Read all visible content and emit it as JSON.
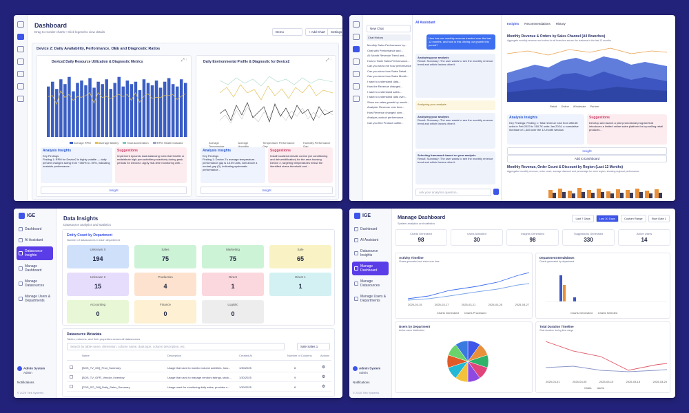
{
  "w1": {
    "title": "Dashboard",
    "subtitle": "Drag to reorder charts • Click legend to view details",
    "controls": {
      "select_value": "Demo",
      "add_chart": "+ Add Chart",
      "settings": "Settings"
    },
    "section_title": "Device 2: Daily Availability, Performance, OEE and Diagnostic Ratios",
    "chart1": {
      "title": "Device2 Daily Resource Utilization & Diagnostic Metrics",
      "legend": [
        "Average RPM",
        "Average Battery",
        "Total Acceleration",
        "RPM Health Indicator"
      ],
      "bars": [
        42,
        46,
        40,
        48,
        44,
        50,
        38,
        45,
        47,
        43,
        49,
        41,
        46,
        44,
        48,
        40,
        45,
        50,
        42,
        47,
        44,
        46,
        39,
        48,
        45,
        43,
        47,
        41,
        46,
        49,
        44,
        42,
        48,
        45
      ]
    },
    "chart2": {
      "title": "Daily Environmental Profile & Diagnostic for Device2",
      "legend": [
        "Average Temperature",
        "Average Humidity",
        "Temperature Performance Gap",
        "Humidity Performance Gap"
      ]
    },
    "insight1": {
      "title": "Analysis Insights",
      "key": "Key Findings",
      "body": "Finding 1: RPM for Device2 is highly volatile — daily percent changes swing from +350% to -90%, indicating unstable performance…"
    },
    "sugg1": {
      "title": "Suggestions",
      "body": "Implement dynamic load-balancing rules that throttle or redistribute high-rpm activities proactively during peak periods for Device2. Apply real-time monitoring with…"
    },
    "insight2": {
      "title": "Analysis Insights",
      "key": "Key Findings",
      "body": "Finding 1: Device 2's average temperature-performance gap is 18.09 units, well above a neutral gap (0), indicating systematic performance…"
    },
    "sugg2": {
      "title": "Suggestions",
      "body": "Install localized climate control (air conditioning and dehumidification) for the area housing Device 2, targeting temperatures below the identified stress threshold and…"
    },
    "insight_btn": "Insight"
  },
  "w2": {
    "chat_label": "AI Assistant",
    "new_chat": "New Chat",
    "chat_history": "Chat History",
    "history": [
      "Monthly Sales Performance by...",
      "Chat with Performance and...",
      "AI: Month Revenue Trend and...",
      "How to Table Sales Performance...",
      "Can you show me how performance...",
      "Can you show how Sales Detail...",
      "Can you show how Sales Month...",
      "I want to understand data...",
      "How the Revenue changed...",
      "I want to understand sales...",
      "I want to understand data over...",
      "Show me sales growth by month...",
      "Analysis: Revenue over time...",
      "How Revenue changed over...",
      "Analyze product performance...",
      "Can you find Product outlier..."
    ],
    "user_msg": "How has our monthly revenue trended over the last 12 months, and how is this driving our growth this period?",
    "steps": [
      "Analyzing your analysis",
      "Analyzing your analysis",
      "Selecting framework based on your analysis"
    ],
    "step_body": "Result: Summary: The user wants to see the monthly revenue trend and which factors drive it.",
    "input_placeholder": "Ask your analytics question...",
    "tabs": [
      "Insights",
      "Recommendations",
      "History"
    ],
    "chart1_title": "Monthly Revenue & Orders by Sales Channel (All Branches)",
    "chart1_sub": "Aggregate monthly revenue and orders for all branches across the business in the last 12 months",
    "legend1": [
      "Retail",
      "Online",
      "Wholesale",
      "Partner"
    ],
    "insights_title": "Analysis Insights",
    "insights_body": "Key Findings: Finding 1: Total revenue rose from 288.6K units in Feb 2023 to 318.7K units Jan 2024, a cumulative increase of 1,483 over the 12-month window.",
    "sugg_title": "Suggestions",
    "sugg_body": "Develop and launch a pilot promotional program that introduces a limited online sales platform for top-selling retail products…",
    "insight_btn": "Insight",
    "add_btn": "Add to Dashboard",
    "chart2_title": "Monthly Revenue, Order Count & Discount by Region (Last 12 Months)",
    "chart2_sub": "Aggregates monthly revenue, order count, average discount and percentage for each region, showing regional performance."
  },
  "w3": {
    "brand": "IGE",
    "nav": [
      "Dashboard",
      "AI Assistant",
      "Datasource Insights",
      "Manage Dashboard",
      "Manage Datasources",
      "Manage Users & Departments"
    ],
    "active": 2,
    "title": "Data Insights",
    "subtitle": "Datasource analytics and statistics",
    "sec_title": "Entity Count by Department",
    "sec_sub": "Number of datasources in each department",
    "tiles": [
      {
        "label": "Unknown X",
        "value": "194",
        "color": "#cfe0fb"
      },
      {
        "label": "Sales",
        "value": "75",
        "color": "#cdf3d7"
      },
      {
        "label": "Marketing",
        "value": "75",
        "color": "#cdf3d7"
      },
      {
        "label": "Sale",
        "value": "65",
        "color": "#f9f2c5"
      },
      {
        "label": "Unknown 2",
        "value": "15",
        "color": "#e6dcfb"
      },
      {
        "label": "Production",
        "value": "4",
        "color": "#fde3cf"
      },
      {
        "label": "Direct",
        "value": "1",
        "color": "#fbd7de"
      },
      {
        "label": "Direct 1",
        "value": "1",
        "color": "#d3f0f3"
      },
      {
        "label": "Accounting",
        "value": "0",
        "color": "#e8f7d6"
      },
      {
        "label": "Finance",
        "value": "0",
        "color": "#fdf0d3"
      },
      {
        "label": "Logistic",
        "value": "0",
        "color": "#ededed"
      }
    ],
    "meta_title": "Datasource Metadata",
    "meta_sub": "Tables, columns, and their properties across all datasources",
    "search_placeholder": "Search by table name, dimension, column name, data type, column description, etc.",
    "sort": "Sale Sales 1",
    "cols": [
      "Name",
      "Description",
      "Created At",
      "Number of Columns",
      "Actions"
    ],
    "rows": [
      {
        "name": "[BOS_TV_ON]_Prod_Summary",
        "desc": "Usage that used to monitor volume activities, how...",
        "date": "1/30/2025",
        "cols": "8"
      },
      {
        "name": "[BOS_TV_OFF]_Vendor_Inventory",
        "desc": "Usage that used to manage vendors listings, stock...",
        "date": "1/30/2025",
        "cols": "9"
      },
      {
        "name": "[POS_SO_ON]_Daily_Sales_Summary",
        "desc": "Usage used for monitoring daily sales, provides s...",
        "date": "1/30/2025",
        "cols": "8"
      }
    ],
    "user": "Admin System",
    "user_role": "Admin",
    "notif": "Notifications",
    "footer": "© 2025 Ttek Systems"
  },
  "w4": {
    "brand": "IGE",
    "nav": [
      "Dashboard",
      "AI Assistant",
      "Datasource Insights",
      "Manage Dashboard",
      "Manage Datasources",
      "Manage Users & Departments"
    ],
    "active": 3,
    "title": "Manage Dashboard",
    "subtitle": "System analytics and statistics",
    "ranges": [
      "Last 7 Days",
      "Last 30 Days",
      "Custom Range",
      "Start Date 1"
    ],
    "kpis": [
      {
        "label": "Charts Generated",
        "value": "98"
      },
      {
        "label": "Users Activated",
        "value": "30"
      },
      {
        "label": "Insights Generated",
        "value": "98"
      },
      {
        "label": "Suggestions Generated",
        "value": "330"
      },
      {
        "label": "Active Users",
        "value": "14"
      }
    ],
    "activity_title": "Activity Timeline",
    "activity_sub": "Charts generated and shots over time",
    "activity_dates": [
      "2025-03-15",
      "2025-03-17",
      "2025-03-21",
      "2025-03-25",
      "2025-03-27"
    ],
    "activity_legend": [
      "Charts Generated",
      "Charts Processed"
    ],
    "dept_title": "Department Breakdown",
    "dept_sub": "Charts generated by department",
    "dept_cats": [
      "Sales",
      "Finance",
      "HR",
      "Marketing",
      "Production",
      "IT",
      "Logistic",
      "Accounting"
    ],
    "dept_legend": [
      "Charts Generated",
      "Charts Selected"
    ],
    "users_title": "Users by Department",
    "users_sub": "Active users distribution",
    "pie_labels": [
      "Marketing 2",
      "Sales 1",
      "Production",
      "Accounting 4",
      "Sale 4",
      "Direct 4",
      "Finance 2",
      "Logistic 1",
      "HR 4",
      "IT 3"
    ],
    "dur_title": "Total Duration Timeline",
    "dur_sub": "Chat duration during time range",
    "dur_dates": [
      "2025-03-01",
      "2025-03-05",
      "2025-03-10",
      "2025-03-15",
      "2025-03-20"
    ],
    "dur_legend": [
      "Chats",
      "Users"
    ],
    "user": "Admin System",
    "user_role": "Admin",
    "notif": "Notifications",
    "footer": "© 2025 Ttek Systems"
  }
}
